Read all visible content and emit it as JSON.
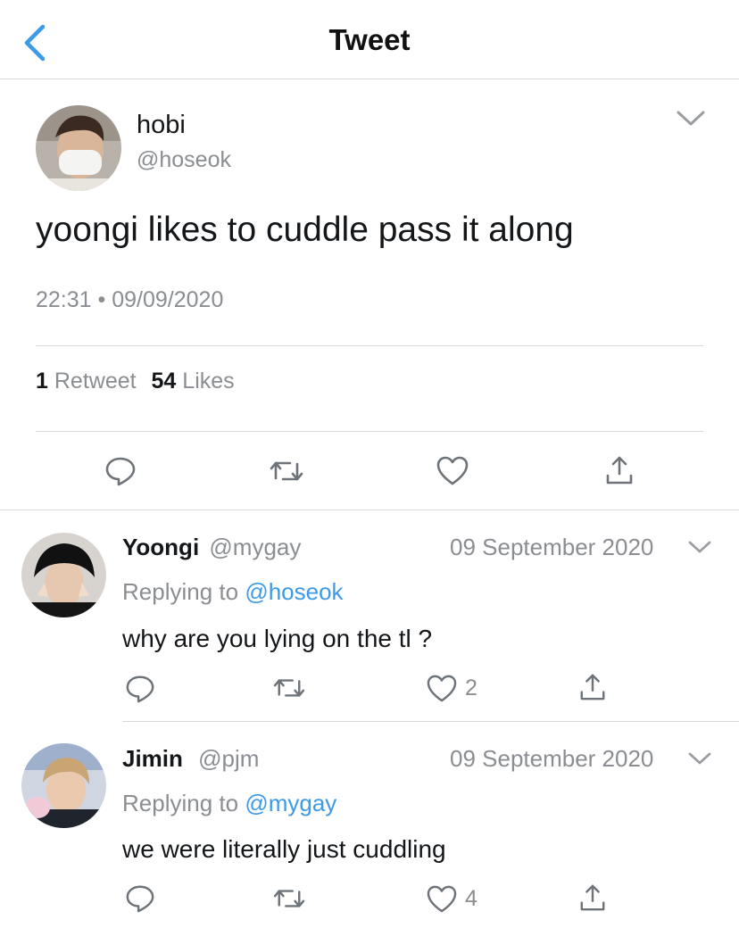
{
  "header": {
    "title": "Tweet"
  },
  "tweet": {
    "name": "hobi",
    "handle": "@hoseok",
    "text": "yoongi likes to cuddle pass it along",
    "time": "22:31",
    "separator": "•",
    "date": "09/09/2020",
    "retweet_count": "1",
    "retweet_label": "Retweet",
    "likes_count": "54",
    "likes_label": "Likes"
  },
  "replies": [
    {
      "name": "Yoongi",
      "handle": "@mygay",
      "date": "09 September 2020",
      "replying_prefix": "Replying to",
      "replying_to": "@hoseok",
      "text": "why are you lying on the tl ?",
      "like_count": "2"
    },
    {
      "name": "Jimin",
      "handle": "@pjm",
      "date": "09 September 2020",
      "replying_prefix": "Replying to",
      "replying_to": "@mygay",
      "text": "we were literally just cuddling",
      "like_count": "4"
    }
  ],
  "colors": {
    "accent": "#3d9ae8",
    "muted": "#8a8d91",
    "divider": "#d8d8d8",
    "text": "#14171a"
  },
  "icons": [
    "back-chevron-icon",
    "chevron-down-icon",
    "reply-icon",
    "retweet-icon",
    "heart-icon",
    "share-icon"
  ]
}
